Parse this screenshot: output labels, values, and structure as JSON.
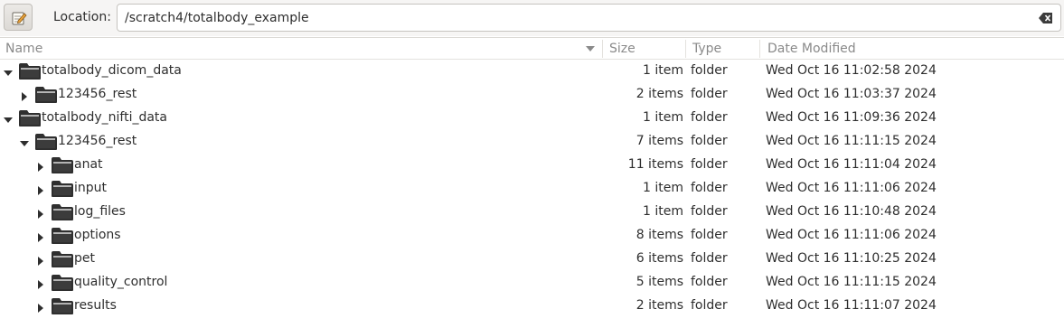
{
  "toolbar": {
    "edit_icon": "edit-location-icon",
    "location_label": "Location:",
    "location_value": "/scratch4/totalbody_example",
    "clear_icon": "clear-text-icon"
  },
  "columns": {
    "name": "Name",
    "size": "Size",
    "type": "Type",
    "date": "Date Modified"
  },
  "rows": [
    {
      "name": "totalbody_dicom_data",
      "size": "1 item",
      "type": "folder",
      "date": "Wed Oct 16 11:02:58 2024",
      "depth": 0,
      "expanded": true
    },
    {
      "name": "123456_rest",
      "size": "2 items",
      "type": "folder",
      "date": "Wed Oct 16 11:03:37 2024",
      "depth": 1,
      "expanded": false
    },
    {
      "name": "totalbody_nifti_data",
      "size": "1 item",
      "type": "folder",
      "date": "Wed Oct 16 11:09:36 2024",
      "depth": 0,
      "expanded": true
    },
    {
      "name": "123456_rest",
      "size": "7 items",
      "type": "folder",
      "date": "Wed Oct 16 11:11:15 2024",
      "depth": 1,
      "expanded": true
    },
    {
      "name": "anat",
      "size": "11 items",
      "type": "folder",
      "date": "Wed Oct 16 11:11:04 2024",
      "depth": 2,
      "expanded": false
    },
    {
      "name": "input",
      "size": "1 item",
      "type": "folder",
      "date": "Wed Oct 16 11:11:06 2024",
      "depth": 2,
      "expanded": false
    },
    {
      "name": "log_files",
      "size": "1 item",
      "type": "folder",
      "date": "Wed Oct 16 11:10:48 2024",
      "depth": 2,
      "expanded": false
    },
    {
      "name": "options",
      "size": "8 items",
      "type": "folder",
      "date": "Wed Oct 16 11:11:06 2024",
      "depth": 2,
      "expanded": false
    },
    {
      "name": "pet",
      "size": "6 items",
      "type": "folder",
      "date": "Wed Oct 16 11:10:25 2024",
      "depth": 2,
      "expanded": false
    },
    {
      "name": "quality_control",
      "size": "5 items",
      "type": "folder",
      "date": "Wed Oct 16 11:11:15 2024",
      "depth": 2,
      "expanded": false
    },
    {
      "name": "results",
      "size": "2 items",
      "type": "folder",
      "date": "Wed Oct 16 11:11:07 2024",
      "depth": 2,
      "expanded": false
    }
  ]
}
